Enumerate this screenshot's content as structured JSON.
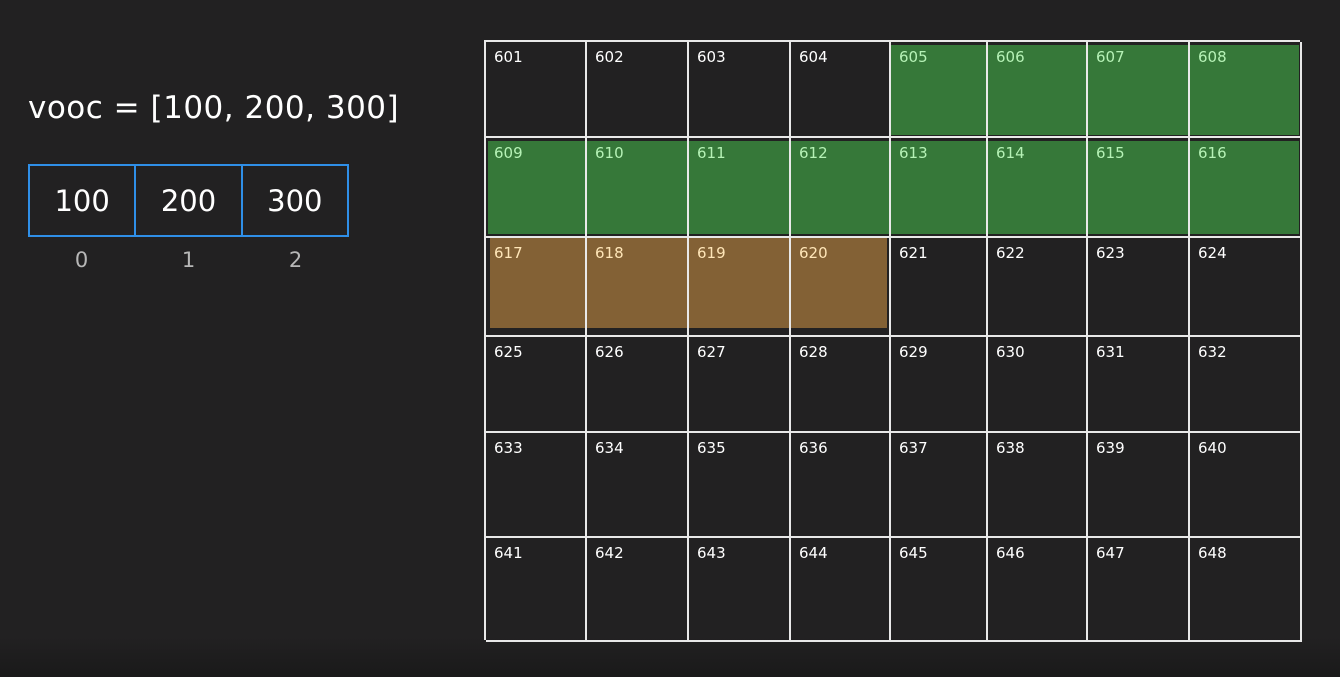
{
  "code": {
    "text": "vooc = [100, 200, 300]"
  },
  "array": {
    "values": [
      "100",
      "200",
      "300"
    ],
    "indices": [
      "0",
      "1",
      "2"
    ],
    "border_color": "#2f8fe8"
  },
  "memory": {
    "cells": [
      "601",
      "602",
      "603",
      "604",
      "605",
      "606",
      "607",
      "608",
      "609",
      "610",
      "611",
      "612",
      "613",
      "614",
      "615",
      "616",
      "617",
      "618",
      "619",
      "620",
      "621",
      "622",
      "623",
      "624",
      "625",
      "626",
      "627",
      "628",
      "629",
      "630",
      "631",
      "632",
      "633",
      "634",
      "635",
      "636",
      "637",
      "638",
      "639",
      "640",
      "641",
      "642",
      "643",
      "644",
      "645",
      "646",
      "647",
      "648"
    ],
    "green_cells": [
      "605",
      "606",
      "607",
      "608",
      "609",
      "610",
      "611",
      "612",
      "613",
      "614",
      "615",
      "616"
    ],
    "orange_cells": [
      "617",
      "618",
      "619",
      "620"
    ],
    "colors": {
      "green": "#38803c",
      "orange": "#8b6637",
      "grid_line": "#e9e9e9",
      "background": "#222122"
    }
  }
}
